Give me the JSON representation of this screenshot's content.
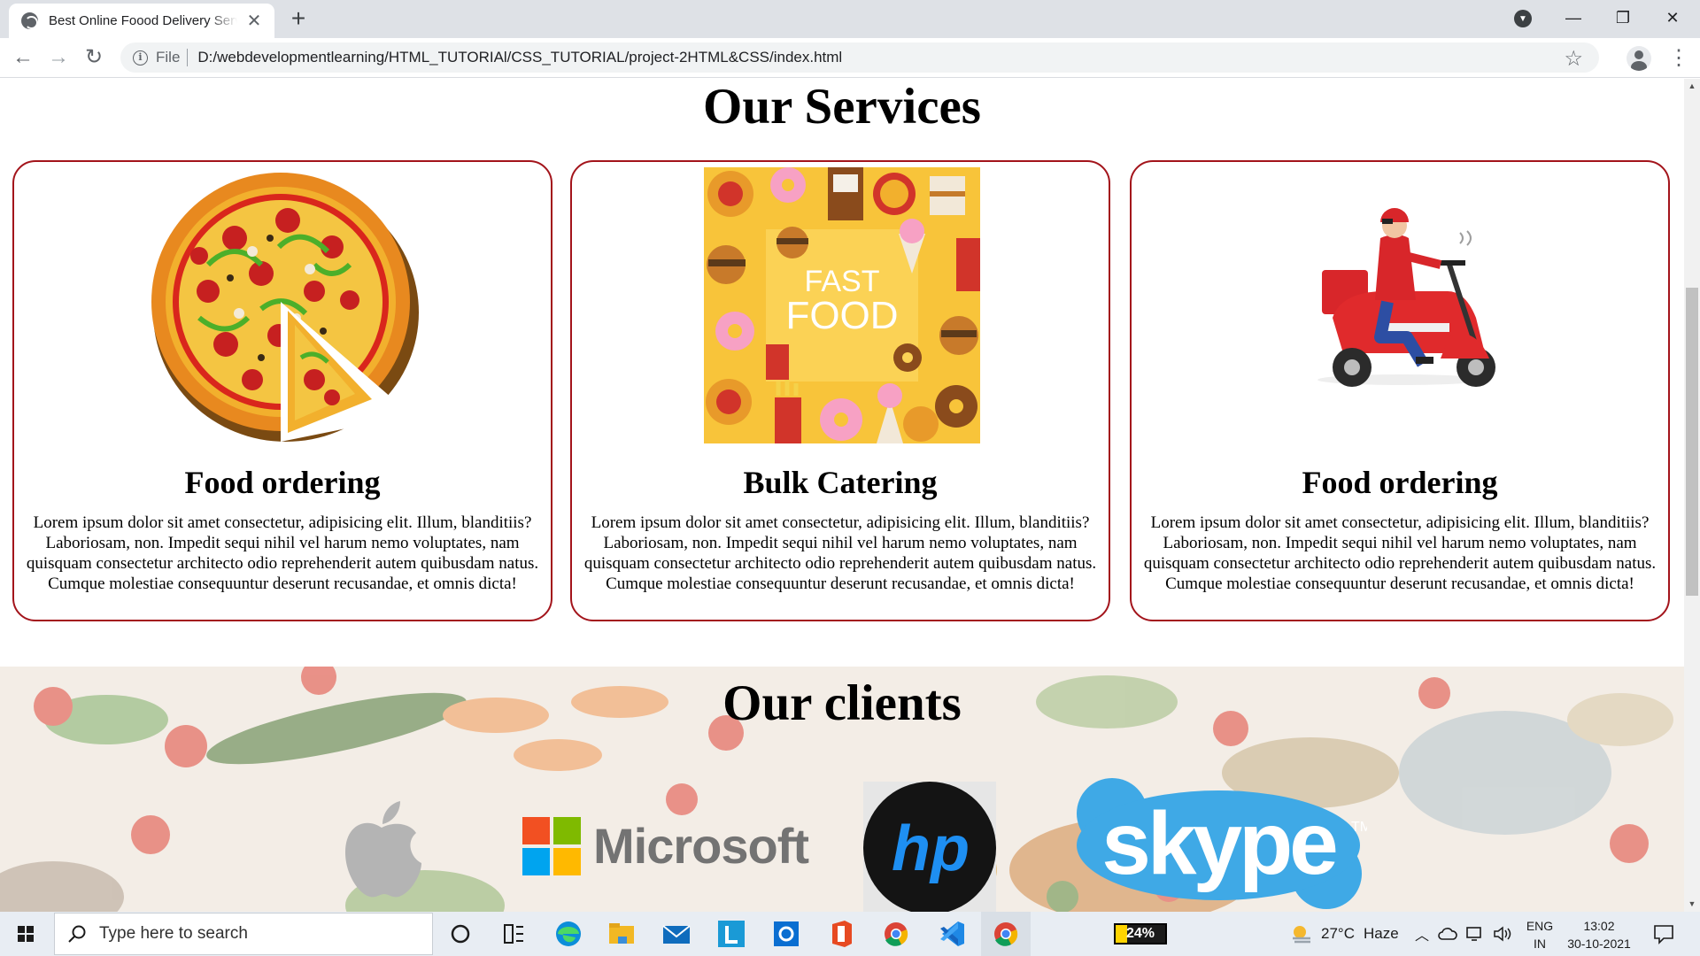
{
  "browser": {
    "tab_title": "Best Online Foood Delivery Service",
    "tab_close_glyph": "✕",
    "new_tab_glyph": "+",
    "url_scheme": "File",
    "url": "D:/webdevelopmentlearning/HTML_TUTORIAl/CSS_TUTORIAL/project-2HTML&CSS/index.html",
    "back_glyph": "←",
    "forward_glyph": "→",
    "reload_glyph": "↻",
    "star_glyph": "☆",
    "menu_glyph": "⋮",
    "minimize_glyph": "—",
    "restore_glyph": "❐",
    "close_glyph": "✕",
    "tab_search_glyph": "▼"
  },
  "page": {
    "services_title": "Our Services",
    "cards": [
      {
        "title": "Food ordering",
        "image": "pizza-image",
        "text": "Lorem ipsum dolor sit amet consectetur, adipisicing elit. Illum, blanditiis? Laboriosam, non. Impedit sequi nihil vel harum nemo voluptates, nam quisquam consectetur architecto odio reprehenderit autem quibusdam natus. Cumque molestiae consequuntur deserunt recusandae, et omnis dicta!"
      },
      {
        "title": "Bulk Catering",
        "image": "fast-food-image",
        "image_text_1": "FAST",
        "image_text_2": "FOOD",
        "text": "Lorem ipsum dolor sit amet consectetur, adipisicing elit. Illum, blanditiis? Laboriosam, non. Impedit sequi nihil vel harum nemo voluptates, nam quisquam consectetur architecto odio reprehenderit autem quibusdam natus. Cumque molestiae consequuntur deserunt recusandae, et omnis dicta!"
      },
      {
        "title": "Food ordering",
        "image": "delivery-scooter-image",
        "text": "Lorem ipsum dolor sit amet consectetur, adipisicing elit. Illum, blanditiis? Laboriosam, non. Impedit sequi nihil vel harum nemo voluptates, nam quisquam consectetur architecto odio reprehenderit autem quibusdam natus. Cumque molestiae consequuntur deserunt recusandae, et omnis dicta!"
      }
    ],
    "clients_title": "Our clients",
    "clients": [
      {
        "name": "apple-logo"
      },
      {
        "name": "microsoft-logo",
        "text": "Microsoft"
      },
      {
        "name": "hp-logo",
        "text": "hp"
      },
      {
        "name": "skype-logo",
        "text": "skype",
        "mark": "TM"
      }
    ],
    "colors": {
      "card_border": "#a3141b",
      "scroll_track": "#f1f1f1"
    }
  },
  "taskbar": {
    "search_placeholder": "Type here to search",
    "battery": "24%",
    "battery_level": 0.24,
    "temperature": "27°C",
    "weather": "Haze",
    "lang_1": "ENG",
    "lang_2": "IN",
    "time": "13:02",
    "date": "30-10-2021",
    "apps": [
      "task-view-icon",
      "edge-icon",
      "file-explorer-icon",
      "mail-icon",
      "l-app-icon",
      "outlook-icon",
      "office-icon",
      "chrome-icon",
      "vscode-icon",
      "chrome-active-icon"
    ]
  }
}
